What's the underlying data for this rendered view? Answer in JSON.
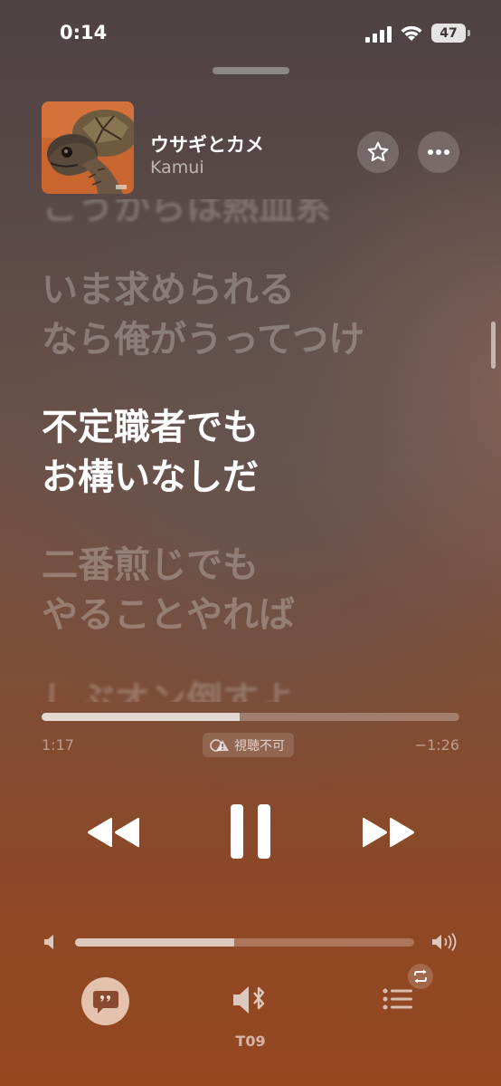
{
  "status_bar": {
    "time": "0:14",
    "battery": "47"
  },
  "now_playing": {
    "title": "ウサギとカメ",
    "artist": "Kamui"
  },
  "lyrics": [
    "こうからは熱血系",
    "いま求められる",
    "なら俺がうってつけ",
    "不定職者でも",
    "お構いなしだ",
    "二番煎じでも",
    "やることやれば",
    "しぶオン倒すよ"
  ],
  "active_lines": [
    3,
    4
  ],
  "playback": {
    "elapsed": "1:17",
    "remaining": "−1:26",
    "progress": 0.475,
    "badge": "視聴不可"
  },
  "volume": {
    "level": 0.47
  },
  "output_device": "T09",
  "icons": {
    "star": "star-icon",
    "more": "more-icon",
    "rewind": "rewind-icon",
    "pause": "pause-icon",
    "forward": "fast-forward-icon",
    "volume_low": "speaker-low-icon",
    "volume_high": "speaker-high-icon",
    "lyrics": "quote-bubble-icon",
    "airplay": "speaker-bluetooth-icon",
    "queue": "list-icon",
    "repeat": "repeat-icon"
  }
}
